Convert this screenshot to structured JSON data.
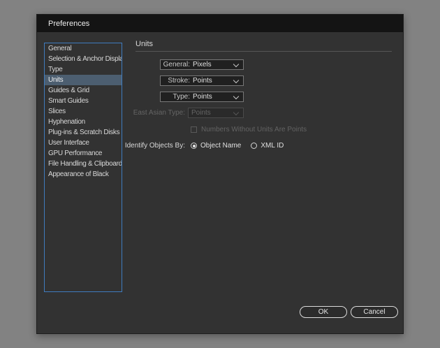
{
  "window": {
    "title": "Preferences"
  },
  "sidebar": {
    "items": [
      {
        "label": "General",
        "selected": false
      },
      {
        "label": "Selection & Anchor Display",
        "selected": false
      },
      {
        "label": "Type",
        "selected": false
      },
      {
        "label": "Units",
        "selected": true
      },
      {
        "label": "Guides & Grid",
        "selected": false
      },
      {
        "label": "Smart Guides",
        "selected": false
      },
      {
        "label": "Slices",
        "selected": false
      },
      {
        "label": "Hyphenation",
        "selected": false
      },
      {
        "label": "Plug-ins & Scratch Disks",
        "selected": false
      },
      {
        "label": "User Interface",
        "selected": false
      },
      {
        "label": "GPU Performance",
        "selected": false
      },
      {
        "label": "File Handling & Clipboard",
        "selected": false
      },
      {
        "label": "Appearance of Black",
        "selected": false
      }
    ]
  },
  "panel": {
    "title": "Units",
    "dropdowns": [
      {
        "label": "General:",
        "value": "Pixels",
        "disabled": false
      },
      {
        "label": "Stroke:",
        "value": "Points",
        "disabled": false
      },
      {
        "label": "Type:",
        "value": "Points",
        "disabled": false
      },
      {
        "label": "East Asian Type:",
        "value": "Points",
        "disabled": true
      }
    ],
    "checkbox": {
      "label": "Numbers Without Units Are Points",
      "checked": false,
      "disabled": true
    },
    "identify": {
      "label": "Identify Objects By:",
      "options": [
        {
          "label": "Object Name",
          "selected": true
        },
        {
          "label": "XML ID",
          "selected": false
        }
      ]
    }
  },
  "buttons": {
    "ok": "OK",
    "cancel": "Cancel"
  },
  "colors": {
    "dialog_background": "#323232",
    "titlebar_background": "#141414",
    "sidebar_focus_border": "#3f7cbf",
    "selection_highlight": "#4c5e70",
    "desktop_background": "#828282"
  }
}
